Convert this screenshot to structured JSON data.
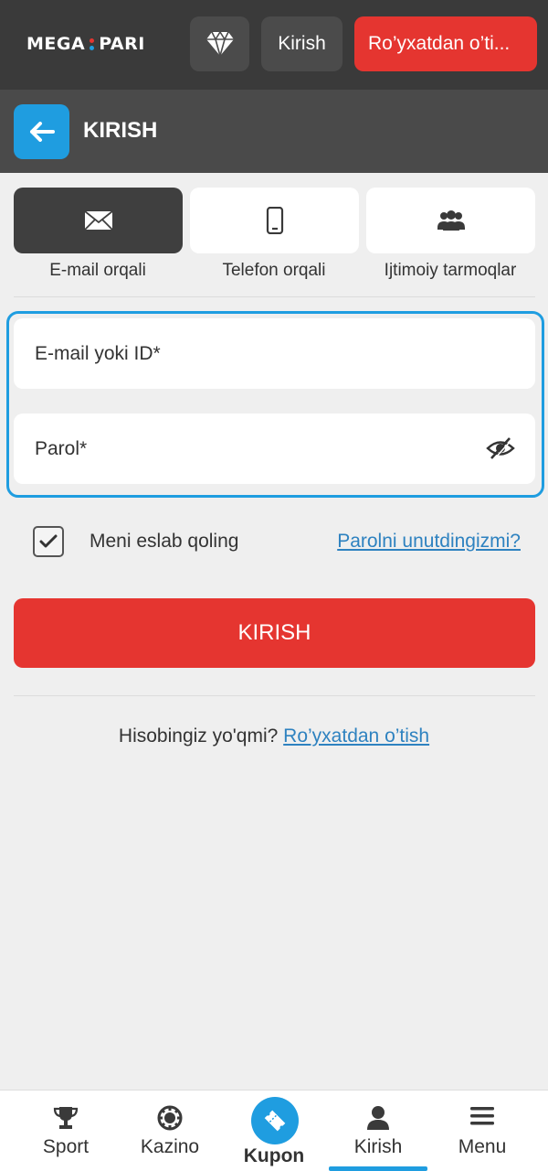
{
  "header": {
    "logo_left": "MEGA",
    "logo_right": "PARI",
    "logo_dot_colors": [
      "#e53530",
      "#1f9de0"
    ],
    "gem_icon": "diamond-icon",
    "login_label": "Kirish",
    "register_label": "Ro’yxatdan o’ti..."
  },
  "titlebar": {
    "back_icon": "arrow-left-icon",
    "title": "KIRISH"
  },
  "tabs": [
    {
      "label": "E-mail orqali",
      "icon": "envelope-icon",
      "active": true
    },
    {
      "label": "Telefon orqali",
      "icon": "phone-icon",
      "active": false
    },
    {
      "label": "Ijtimoiy tarmoqlar",
      "icon": "users-icon",
      "active": false
    }
  ],
  "form": {
    "email_placeholder": "E-mail yoki ID*",
    "email_value": "",
    "password_placeholder": "Parol*",
    "password_value": "",
    "eye_icon": "eye-slash-icon"
  },
  "remember": {
    "label": "Meni eslab qoling",
    "checked": true
  },
  "forgot_link": "Parolni unutdingizmi?",
  "submit_label": "KIRISH",
  "no_account": {
    "text": "Hisobingiz yo'qmi?",
    "link": "Ro’yxatdan o’tish"
  },
  "bottom_nav": [
    {
      "label": "Sport",
      "icon": "trophy-icon"
    },
    {
      "label": "Kazino",
      "icon": "casino-chip-icon"
    },
    {
      "label": "Kupon",
      "icon": "ticket-icon"
    },
    {
      "label": "Kirish",
      "icon": "user-icon",
      "active": true
    },
    {
      "label": "Menu",
      "icon": "menu-icon"
    }
  ],
  "colors": {
    "accent_blue": "#1f9de0",
    "accent_red": "#e53530",
    "header_bg": "#3a3a3a",
    "titlebar_bg": "#4a4a4a",
    "page_bg": "#efefef"
  }
}
